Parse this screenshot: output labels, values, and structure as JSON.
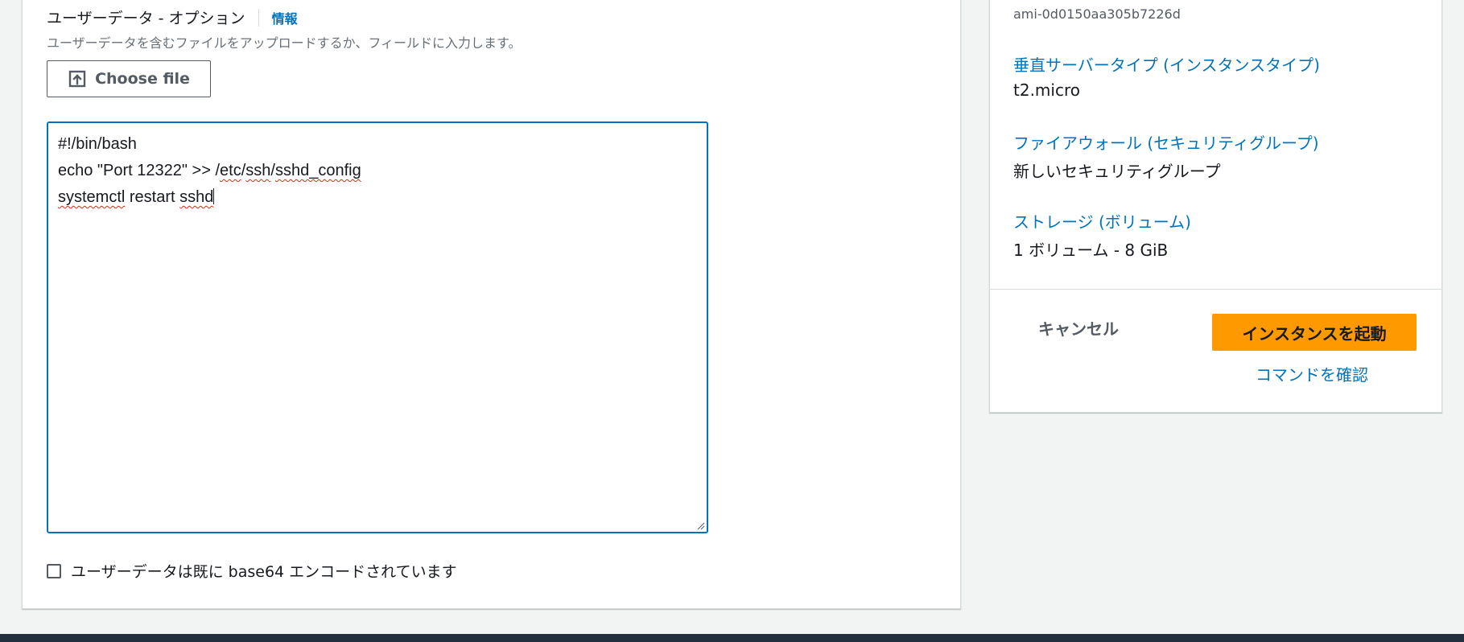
{
  "user_data": {
    "title": "ユーザーデータ - オプション",
    "info_link": "情報",
    "description": "ユーザーデータを含むファイルをアップロードするか、フィールドに入力します。",
    "choose_file_label": "Choose file",
    "choose_file_icon": "upload-icon",
    "lines": [
      {
        "segments": [
          {
            "text": "#!/bin/bash",
            "spell": false
          }
        ]
      },
      {
        "segments": [
          {
            "text": "echo \"Port 12322\" >> /",
            "spell": false
          },
          {
            "text": "etc",
            "spell": true
          },
          {
            "text": "/",
            "spell": false
          },
          {
            "text": "ssh",
            "spell": true
          },
          {
            "text": "/",
            "spell": false
          },
          {
            "text": "sshd_config",
            "spell": true
          }
        ]
      },
      {
        "segments": [
          {
            "text": "systemctl",
            "spell": true
          },
          {
            "text": " restart ",
            "spell": false
          },
          {
            "text": "sshd",
            "spell": true
          }
        ]
      }
    ],
    "base64_checkbox_label": "ユーザーデータは既に base64 エンコードされています",
    "base64_checked": false
  },
  "summary": {
    "ami_id": "ami-0d0150aa305b7226d",
    "instance_type_label": "垂直サーバータイプ (インスタンスタイプ)",
    "instance_type_value": "t2.micro",
    "firewall_label": "ファイアウォール (セキュリティグループ)",
    "firewall_value": "新しいセキュリティグループ",
    "storage_label": "ストレージ (ボリューム)",
    "storage_value": "1 ボリューム - 8 GiB",
    "cancel_label": "キャンセル",
    "launch_label": "インスタンスを起動",
    "review_commands_label": "コマンドを確認"
  },
  "colors": {
    "primary_button": "#ff9900",
    "link": "#0073bb",
    "focus_border": "#0073bb",
    "spellcheck": "#d13212",
    "footer": "#232f3e"
  }
}
